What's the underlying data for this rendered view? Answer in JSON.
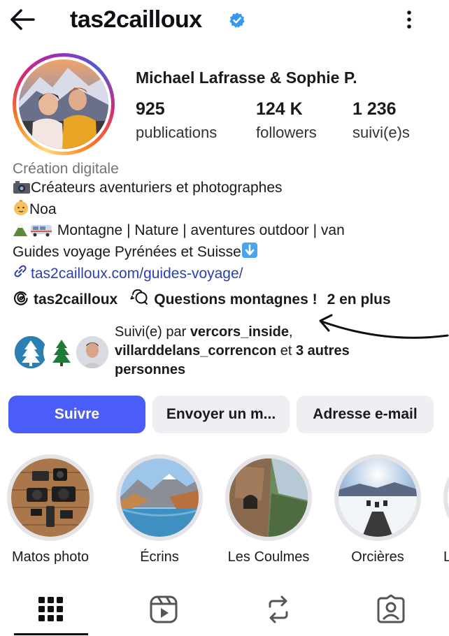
{
  "header": {
    "username": "tas2cailloux",
    "icons": {
      "back": "arrow-left-icon",
      "verified": "verified-badge-icon",
      "more": "kebab-menu-icon"
    }
  },
  "profile": {
    "full_name": "Michael Lafrasse & Sophie P.",
    "stats": [
      {
        "value": "925",
        "label": "publications"
      },
      {
        "value": "124 K",
        "label": "followers"
      },
      {
        "value": "1 236",
        "label": "suivi(e)s"
      }
    ]
  },
  "bio": {
    "category": "Création digitale",
    "lines": [
      {
        "emoji": "camera-emoji",
        "text": "Créateurs aventuriers et photographes"
      },
      {
        "emoji": "baby-emoji",
        "text": "Noa"
      },
      {
        "emoji": "mountain-van-emoji",
        "text": " Montagne | Nature | aventures outdoor | van"
      },
      {
        "emoji": "down-arrow-emoji",
        "text": "Guides voyage Pyrénées et Suisse"
      }
    ],
    "link": "tas2cailloux.com/guides-voyage/"
  },
  "threads": {
    "handle": "tas2cailloux",
    "questions": "Questions montagnes !",
    "more": "2 en plus"
  },
  "followed_by": {
    "prefix": "Suivi(e) par ",
    "user1": "vercors_inside",
    "sep": ",",
    "user2": "villarddelans_correncon",
    "and": " et ",
    "others": "3 autres personnes"
  },
  "actions": {
    "follow": "Suivre",
    "message": "Envoyer un m...",
    "email": "Adresse e-mail"
  },
  "highlights": [
    {
      "label": "Matos photo"
    },
    {
      "label": "Écrins"
    },
    {
      "label": "Les Coulmes"
    },
    {
      "label": "Orcières"
    },
    {
      "label": "Le"
    }
  ],
  "tabs": [
    "grid-icon",
    "reels-icon",
    "reposts-icon",
    "tagged-icon"
  ],
  "colors": {
    "accent": "#4a5df9",
    "link": "#2b3fb0",
    "verified": "#3897f0"
  }
}
